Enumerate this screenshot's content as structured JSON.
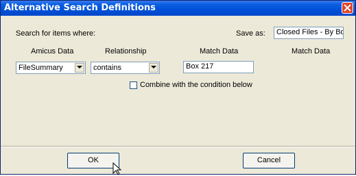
{
  "window": {
    "title": "Alternative Search Definitions"
  },
  "form": {
    "search_for_label": "Search for items where:",
    "save_as_label": "Save as:",
    "save_as_value": "Closed Files - By Box"
  },
  "columns": [
    "Amicus Data",
    "Relationship",
    "Match Data",
    "Match Data"
  ],
  "row": {
    "field": "FileSummary",
    "relationship": "contains",
    "match": "Box 217"
  },
  "combine_label": "Combine with the condition below",
  "buttons": {
    "ok": "OK",
    "cancel": "Cancel"
  }
}
